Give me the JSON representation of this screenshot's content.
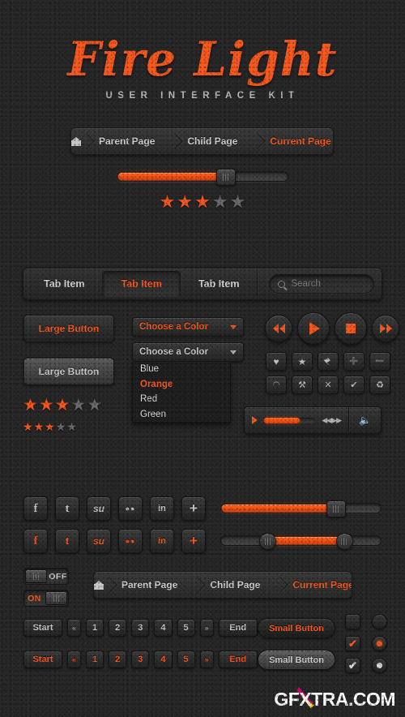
{
  "logo": {
    "title": "Fire Light",
    "subtitle": "USER INTERFACE KIT"
  },
  "colors": {
    "accent": "#f4581f",
    "background": "#272727",
    "panel": "#343434",
    "text": "#c9c9c9"
  },
  "breadcrumb": {
    "home_icon": "home-icon",
    "items": [
      {
        "label": "Parent Page",
        "active": false
      },
      {
        "label": "Child Page",
        "active": false
      },
      {
        "label": "Current Page",
        "active": true
      }
    ]
  },
  "top_slider": {
    "value": 60,
    "label": ""
  },
  "rating_top": {
    "filled": 3,
    "total": 5
  },
  "tabs": {
    "items": [
      {
        "label": "Tab Item",
        "active": false
      },
      {
        "label": "Tab Item",
        "active": true
      },
      {
        "label": "Tab Item",
        "active": false
      }
    ],
    "search": {
      "placeholder": "Search",
      "value": "",
      "icon": "search-icon"
    }
  },
  "buttons": {
    "large_primary": "Large Button",
    "large_secondary": "Large Button",
    "small_primary": "Small Button",
    "small_secondary": "Small Button"
  },
  "selects": {
    "primary": {
      "label": "Choose a Color",
      "caret": "chevron-down-icon"
    },
    "secondary": {
      "label": "Choose a Color",
      "caret": "chevron-down-icon"
    },
    "options": [
      {
        "label": "Blue",
        "selected": false
      },
      {
        "label": "Orange",
        "selected": true
      },
      {
        "label": "Red",
        "selected": false
      },
      {
        "label": "Green",
        "selected": false
      }
    ]
  },
  "ratings": {
    "large": {
      "filled": 3,
      "total": 5
    },
    "small": {
      "filled": 3,
      "total": 5
    }
  },
  "media_controls": [
    {
      "name": "rewind-button",
      "icon": "rewind-icon"
    },
    {
      "name": "play-button",
      "icon": "play-icon"
    },
    {
      "name": "stop-button",
      "icon": "stop-icon"
    },
    {
      "name": "forward-button",
      "icon": "fast-forward-icon"
    }
  ],
  "icon_grid": [
    {
      "name": "heart-icon",
      "glyph": "♥"
    },
    {
      "name": "star-icon",
      "glyph": "★"
    },
    {
      "name": "tag-icon",
      "glyph": "⚑"
    },
    {
      "name": "plus-icon",
      "glyph": "➕"
    },
    {
      "name": "minus-icon",
      "glyph": "➖"
    },
    {
      "name": "rss-icon",
      "glyph": "◠"
    },
    {
      "name": "wrench-icon",
      "glyph": "⚒"
    },
    {
      "name": "close-icon",
      "glyph": "✕"
    },
    {
      "name": "check-icon",
      "glyph": "✔"
    },
    {
      "name": "trash-icon",
      "glyph": "Ὕ1"
    }
  ],
  "player": {
    "play_icon": "play-icon",
    "progress": 70,
    "prev_next_icon": "skip-icon",
    "volume_icon": "volume-icon"
  },
  "social_icons": [
    {
      "name": "facebook-icon",
      "glyph": "f"
    },
    {
      "name": "twitter-icon",
      "glyph": "t"
    },
    {
      "name": "stumbleupon-icon",
      "glyph": "su"
    },
    {
      "name": "flickr-icon",
      "glyph": "●●"
    },
    {
      "name": "linkedin-icon",
      "glyph": "in"
    },
    {
      "name": "googleplus-icon",
      "glyph": "+"
    }
  ],
  "side_sliders": {
    "single": {
      "value": 72
    },
    "range": {
      "start": 28,
      "end": 76
    }
  },
  "toggles": [
    {
      "state": "OFF",
      "label": "OFF",
      "on": false
    },
    {
      "state": "ON",
      "label": "ON",
      "on": true
    }
  ],
  "breadcrumb2": {
    "home_icon": "home-icon",
    "items": [
      {
        "label": "Parent Page",
        "active": false
      },
      {
        "label": "Child Page",
        "active": false
      },
      {
        "label": "Current Page",
        "active": true
      }
    ]
  },
  "pagination": {
    "start": "Start",
    "prev": "«",
    "pages": [
      "1",
      "2",
      "3",
      "4",
      "5"
    ],
    "next": "»",
    "end": "End"
  },
  "check_rows": [
    {
      "checkbox": "",
      "checkbox_state": "unchecked",
      "radio_state": "unselected"
    },
    {
      "checkbox": "✔",
      "checkbox_state": "checked-orange",
      "radio_state": "selected-orange"
    },
    {
      "checkbox": "✔",
      "checkbox_state": "checked-white",
      "radio_state": "selected-white"
    }
  ],
  "watermark": {
    "prefix": "GF",
    "x": "X",
    "suffix": "TRA.COM"
  }
}
